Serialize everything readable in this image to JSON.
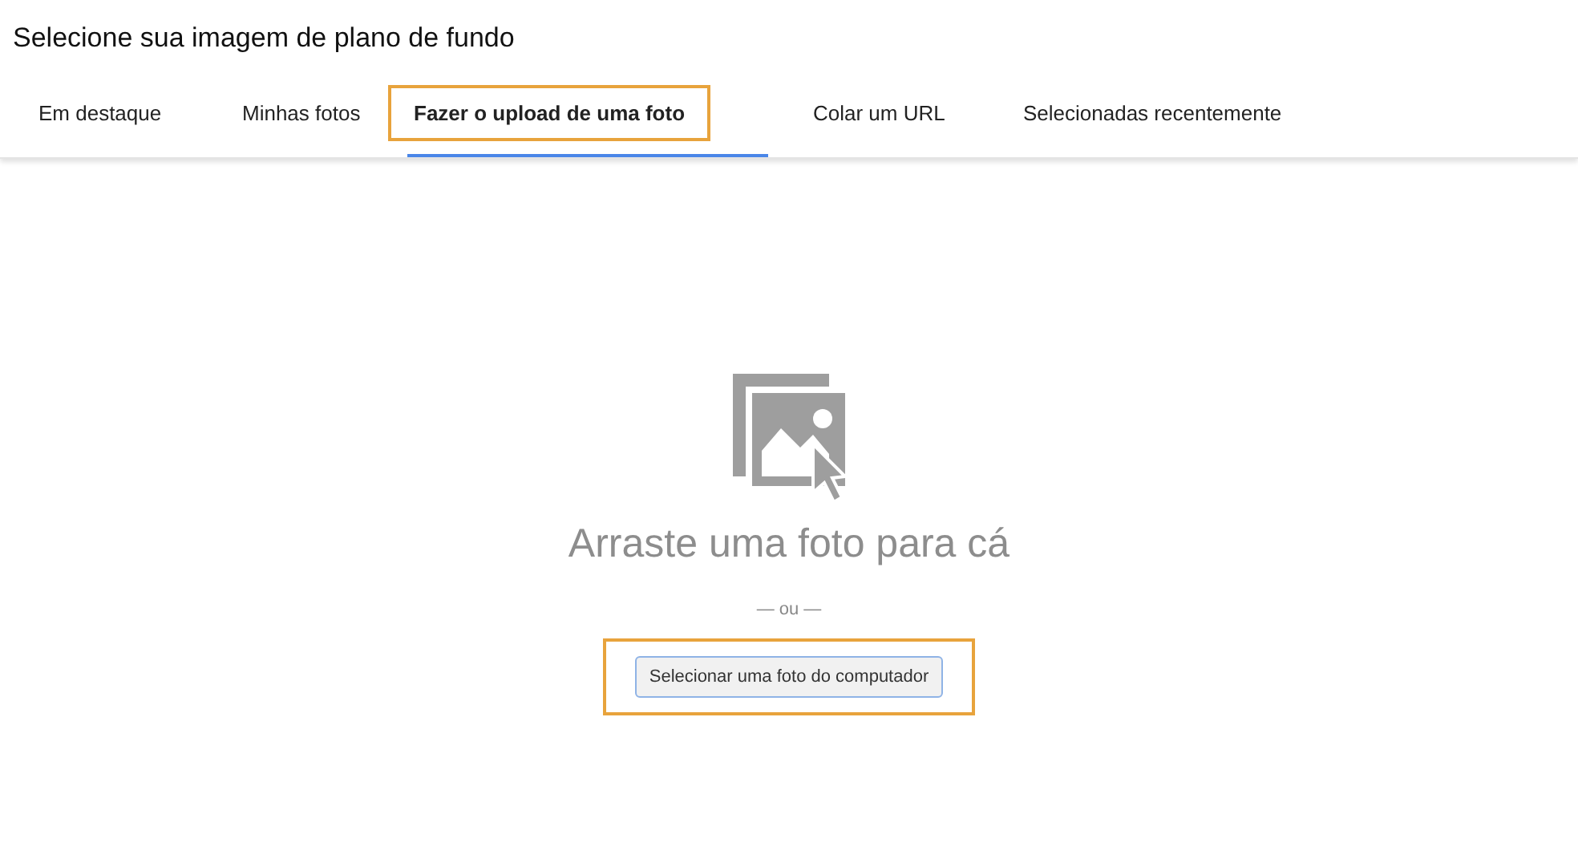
{
  "title": "Selecione sua imagem de plano de fundo",
  "tabs": [
    {
      "label": "Em destaque",
      "selected": false,
      "highlighted": false
    },
    {
      "label": "Minhas fotos",
      "selected": false,
      "highlighted": false
    },
    {
      "label": "Fazer o upload de uma foto",
      "selected": true,
      "highlighted": true
    },
    {
      "label": "Colar um URL",
      "selected": false,
      "highlighted": false
    },
    {
      "label": "Selecionadas recentemente",
      "selected": false,
      "highlighted": false
    }
  ],
  "upload": {
    "drop_text": "Arraste uma foto para cá",
    "separator": "— ou —",
    "button": {
      "label": "Selecionar uma foto do computador",
      "highlighted": true
    }
  }
}
